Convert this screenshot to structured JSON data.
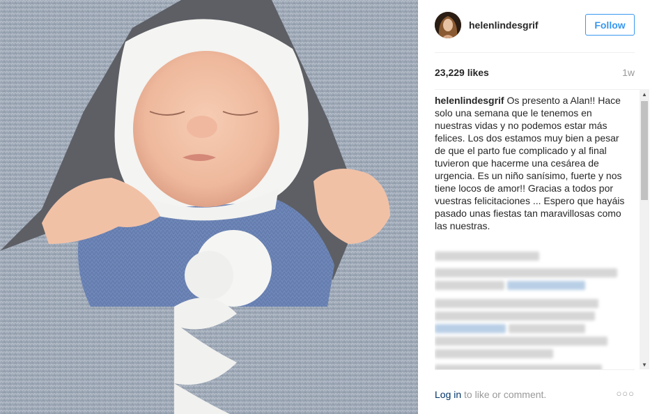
{
  "post": {
    "photo_description": "",
    "author": {
      "username": "helenlindesgrif",
      "follow_label": "Follow"
    },
    "likes": "23,229 likes",
    "time_ago": "1w",
    "caption": {
      "username": "helenlindesgrif",
      "text": "Os presento a Alan!! Hace solo una semana que le tenemos en nuestras vidas y no podemos estar más felices. Los dos estamos muy bien a pesar de que el parto fue complicado y al final tuvieron que hacerme una cesárea de urgencia. Es un niño sanísimo, fuerte y nos tiene locos de amor!! Gracias a todos por vuestras felicitaciones ... Espero que hayáis pasado unas fiestas tan maravillosas como las nuestras."
    },
    "footer": {
      "login_link": "Log in",
      "login_rest": " to like or comment.",
      "more_icon": "ellipsis-icon"
    }
  },
  "colors": {
    "accent": "#3897f0",
    "link": "#003569",
    "muted": "#999999",
    "text": "#262626"
  }
}
